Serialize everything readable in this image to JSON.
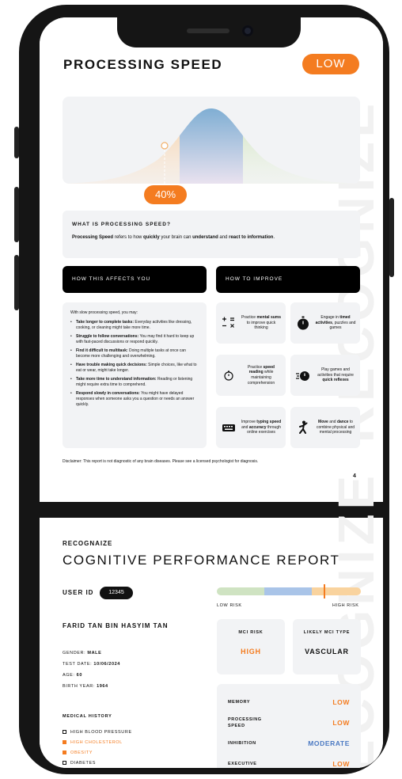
{
  "page1": {
    "title": "PROCESSING SPEED",
    "level": "LOW",
    "percentile": "40%",
    "what_title": "WHAT IS PROCESSING SPEED?",
    "what_body": {
      "part1": "Processing Speed",
      "part2": " refers to how ",
      "part3": "quickly",
      "part4": " your brain can ",
      "part5": "understand",
      "part6": " and ",
      "part7": "react to information",
      "part8": "."
    },
    "affects_header": "HOW THIS AFFECTS YOU",
    "improve_header": "HOW TO IMPROVE",
    "affects_intro": "With slow processing speed, you may:",
    "affects": [
      {
        "bold": "Take longer to complete tasks:",
        "text": " Everyday activities like dressing, cooking, or cleaning might take more time."
      },
      {
        "bold": "Struggle to follow conversations:",
        "text": " You may find it hard to keep up with fast-paced discussions or respond quickly."
      },
      {
        "bold": "Find it difficult to multitask:",
        "text": " Doing multiple tasks at once can become more challenging and overwhelming."
      },
      {
        "bold": "Have trouble making quick decisions:",
        "text": " Simple choices, like what to eat or wear, might take longer."
      },
      {
        "bold": "Take more time to understand information:",
        "text": " Reading or listening might require extra time to comprehend."
      },
      {
        "bold": "Respond slowly in conversations:",
        "text": " You might have delayed responses when someone asks you a question or needs an answer quickly."
      }
    ],
    "tips": [
      {
        "icon": "math-symbols-icon",
        "pre": "Practice ",
        "bold": "mental sums",
        "post": " to improve quick thinking"
      },
      {
        "icon": "stopwatch-icon",
        "pre": "Engage in ",
        "bold": "timed activities",
        "post": ", puzzles and games"
      },
      {
        "icon": "timer-icon",
        "pre": "Practice ",
        "bold": "speed reading",
        "post": " while maintaining comprehension"
      },
      {
        "icon": "fast-timer-icon",
        "pre": "Play games and activities that require ",
        "bold": "quick reflexes",
        "post": ""
      },
      {
        "icon": "keyboard-icon",
        "pre": "Improve ",
        "bold": "typing speed",
        "post": " and ",
        "bold2": "accuracy",
        "post2": " through online exercises"
      },
      {
        "icon": "dance-icon",
        "pre": "",
        "bold": "Move",
        "post": " and ",
        "bold2": "dance",
        "post2": " to combine physical and mental processing"
      }
    ],
    "disclaimer": "Disclaimer: This report is not diagnostic of any brain diseases. Please see a licensed psychologist for diagnosis.",
    "page_number": "4",
    "watermark": "RECOGNIZE"
  },
  "page2": {
    "brand": "RECOGNAIZE",
    "title": "COGNITIVE PERFORMANCE REPORT",
    "user_id_label": "USER ID",
    "user_id": "12345",
    "low_risk": "LOW RISK",
    "high_risk": "HIGH RISK",
    "risk_level": 0.74,
    "name": "FARID TAN BIN HASYIM TAN",
    "gender_label": "GENDER: ",
    "gender": "MALE",
    "test_date_label": "TEST DATE: ",
    "test_date": "10/06/2024",
    "age_label": "AGE: ",
    "age": "60",
    "birth_year_label": "BIRTH YEAR: ",
    "birth_year": "1964",
    "mci_risk_label": "MCI RISK",
    "mci_risk": "HIGH",
    "mci_type_label": "LIKELY MCI TYPE",
    "mci_type": "VASCULAR",
    "scores": [
      {
        "label": "MEMORY",
        "value": "LOW"
      },
      {
        "label": "PROCESSING SPEED",
        "value": "LOW"
      },
      {
        "label": "INHIBITION",
        "value": "MODERATE"
      },
      {
        "label": "EXECUTIVE",
        "value": "LOW"
      }
    ],
    "medical_history_title": "MEDICAL HISTORY",
    "medical_history": [
      {
        "label": "HIGH BLOOD PRESSURE",
        "checked": false
      },
      {
        "label": "HIGH CHOLESTEROL",
        "checked": true
      },
      {
        "label": "OBESITY",
        "checked": true
      },
      {
        "label": "DIABETES",
        "checked": false
      }
    ],
    "watermark": "RECOGNIZE"
  },
  "colors": {
    "accent_orange": "#f47c20",
    "moderate_blue": "#4a78c2",
    "risk_green": "#cfe3c2",
    "risk_blue": "#a9c4e8",
    "risk_orange": "#f9d39e"
  }
}
